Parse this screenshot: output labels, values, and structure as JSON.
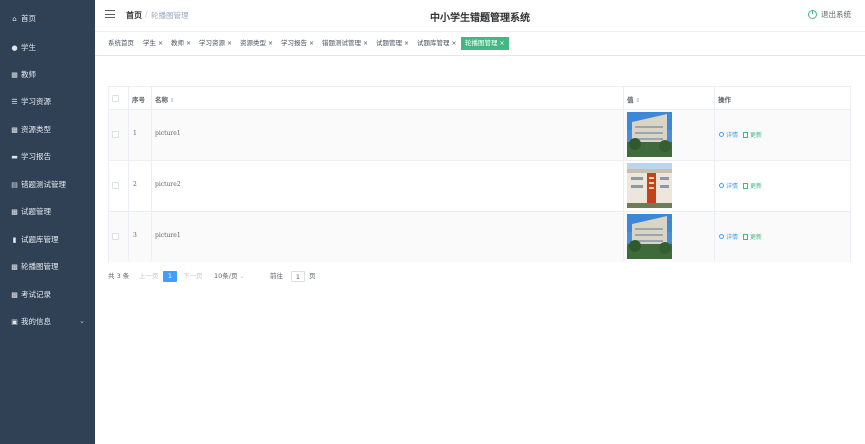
{
  "sidebar": {
    "items": [
      {
        "label": "首页",
        "icon": "home-icon",
        "glyph": "⌂"
      },
      {
        "label": "学生",
        "icon": "user-icon",
        "glyph": "●"
      },
      {
        "label": "教师",
        "icon": "grid-icon",
        "glyph": "▦"
      },
      {
        "label": "学习资源",
        "icon": "list-icon",
        "glyph": "☰"
      },
      {
        "label": "资源类型",
        "icon": "apps-icon",
        "glyph": "▩"
      },
      {
        "label": "学习报告",
        "icon": "card-icon",
        "glyph": "▬"
      },
      {
        "label": "错题测试管理",
        "icon": "doc-icon",
        "glyph": "▤"
      },
      {
        "label": "试题管理",
        "icon": "apps-icon",
        "glyph": "▩"
      },
      {
        "label": "试题库管理",
        "icon": "chart-icon",
        "glyph": "▮"
      },
      {
        "label": "轮播图管理",
        "icon": "apps-icon",
        "glyph": "▩"
      },
      {
        "label": "考试记录",
        "icon": "apps-icon",
        "glyph": "▩"
      },
      {
        "label": "我的信息",
        "icon": "calendar-icon",
        "glyph": "▣"
      }
    ],
    "expand_glyph": "⌄"
  },
  "header": {
    "home": "首页",
    "separator": "/",
    "current": "轮播图管理",
    "title": "中小学生错题管理系统",
    "logout": "退出系统"
  },
  "tags": [
    {
      "label": "系统首页",
      "closable": false
    },
    {
      "label": "学生",
      "closable": true
    },
    {
      "label": "教师",
      "closable": true
    },
    {
      "label": "学习资源",
      "closable": true
    },
    {
      "label": "资源类型",
      "closable": true
    },
    {
      "label": "学习报告",
      "closable": true
    },
    {
      "label": "错题测试管理",
      "closable": true
    },
    {
      "label": "试题管理",
      "closable": true
    },
    {
      "label": "试题库管理",
      "closable": true
    },
    {
      "label": "轮播图管理",
      "closable": true,
      "active": true
    }
  ],
  "tag_close_glyph": "×",
  "table": {
    "columns": {
      "index": "序号",
      "name": "名称",
      "value": "值",
      "ops": "操作"
    },
    "sort_glyph": "⇕",
    "rows": [
      {
        "index": "1",
        "name": "picture1",
        "image": "building-photo"
      },
      {
        "index": "2",
        "name": "picture2",
        "image": "campus-photo"
      },
      {
        "index": "3",
        "name": "picture1",
        "image": "building-photo"
      }
    ],
    "op_detail": "详情",
    "op_update": "更新"
  },
  "pagination": {
    "total": "共 3 条",
    "prev": "上一页",
    "page": "1",
    "next": "下一页",
    "page_size": "10条/页",
    "size_chevron": "⌄",
    "goto_prefix": "前往",
    "goto_value": "1",
    "goto_suffix": "页"
  },
  "colors": {
    "sidebar_bg": "#304156",
    "accent_green": "#42b983",
    "primary_blue": "#409eff"
  }
}
